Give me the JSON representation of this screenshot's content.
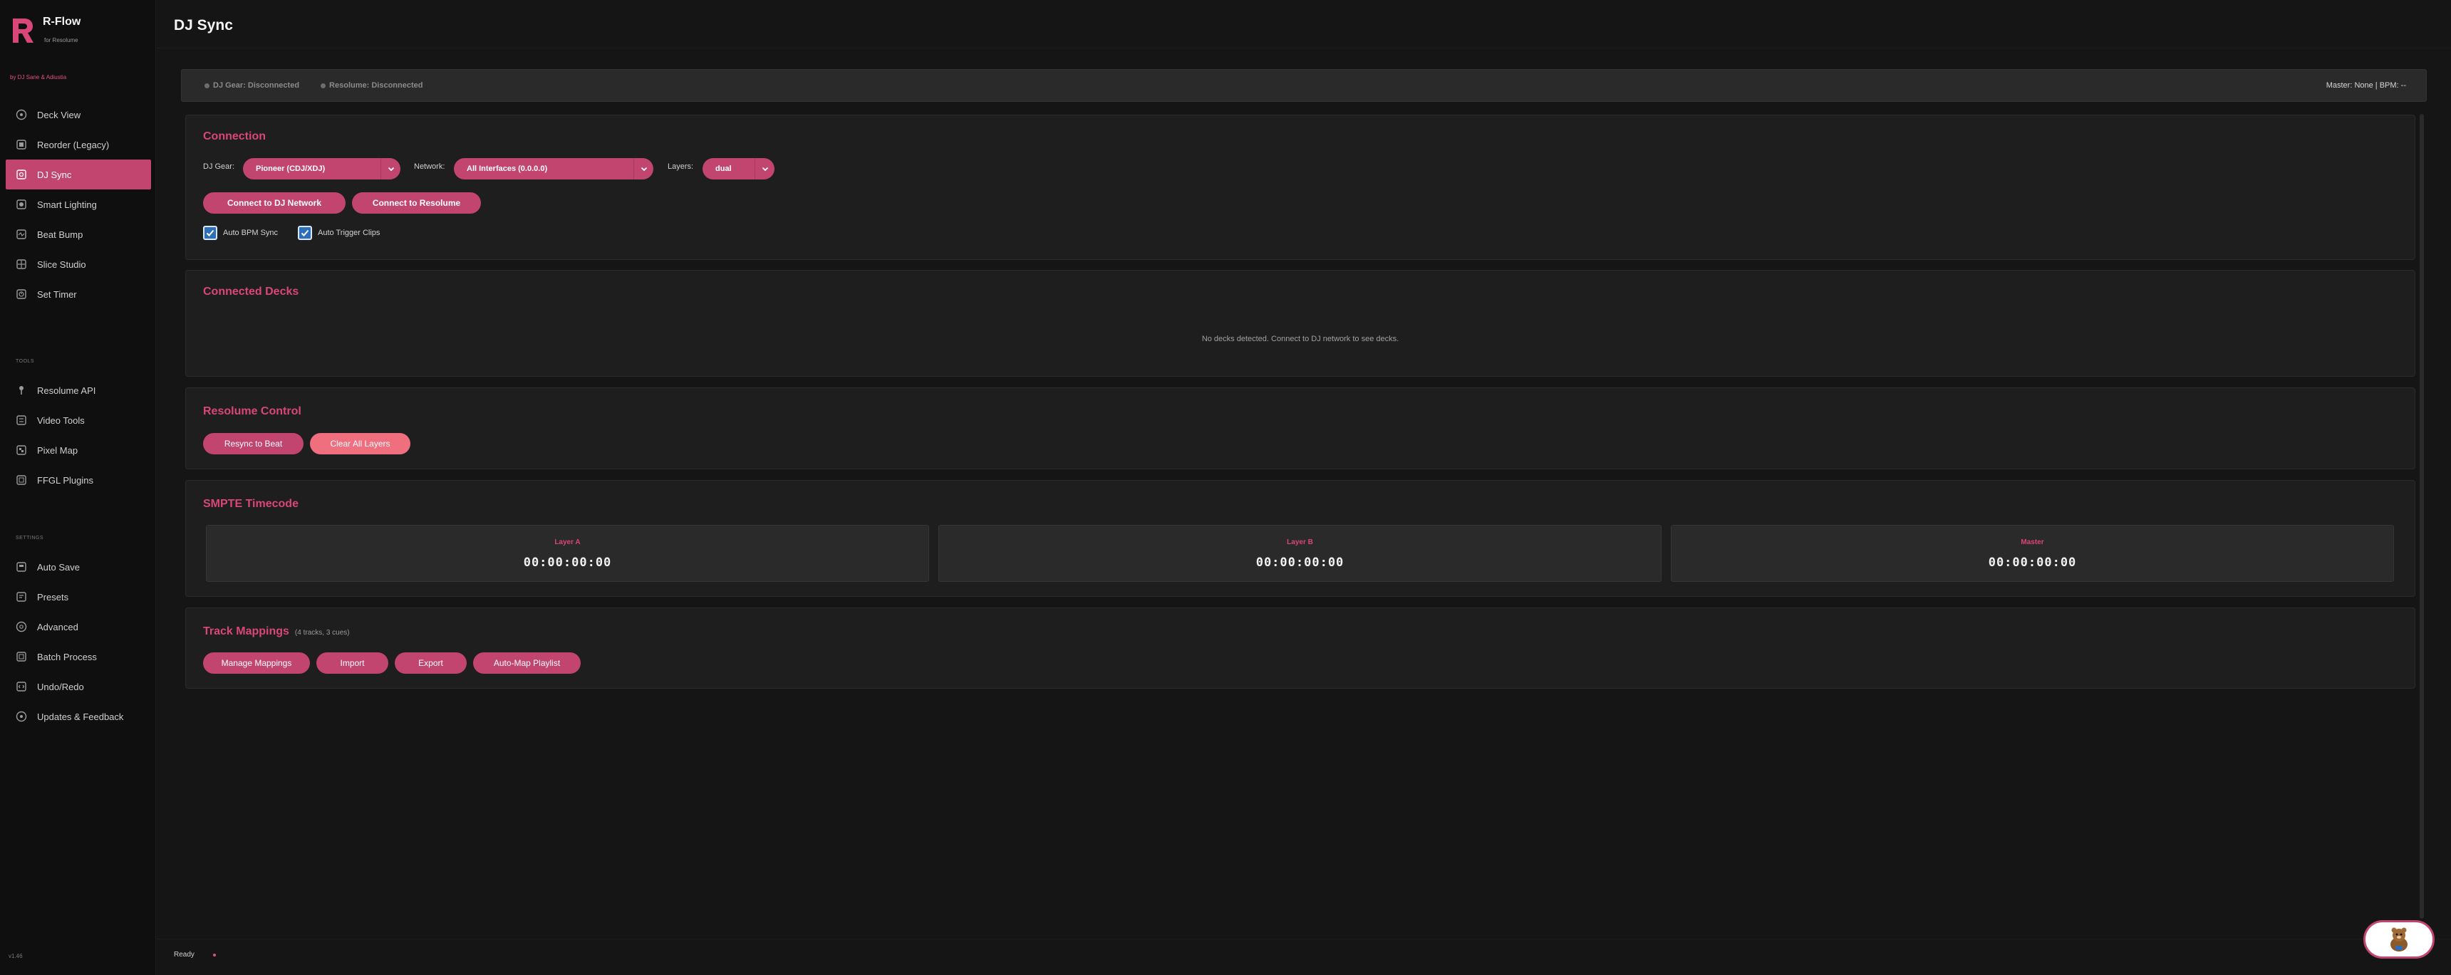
{
  "brand": {
    "title": "R-Flow",
    "subtitle": "for Resolume",
    "byline": "by DJ Sane & Adiustia"
  },
  "sidebar": {
    "main_items": [
      {
        "label": "Deck View",
        "icon": "deck-view-icon"
      },
      {
        "label": "Reorder (Legacy)",
        "icon": "reorder-icon"
      },
      {
        "label": "DJ Sync",
        "icon": "dj-sync-icon",
        "active": true
      },
      {
        "label": "Smart Lighting",
        "icon": "smart-lighting-icon"
      },
      {
        "label": "Beat Bump",
        "icon": "beat-bump-icon"
      },
      {
        "label": "Slice Studio",
        "icon": "slice-studio-icon"
      },
      {
        "label": "Set Timer",
        "icon": "set-timer-icon"
      }
    ],
    "tools_label": "TOOLS",
    "tools_items": [
      {
        "label": "Resolume API",
        "icon": "resolume-api-icon"
      },
      {
        "label": "Video Tools",
        "icon": "video-tools-icon"
      },
      {
        "label": "Pixel Map",
        "icon": "pixel-map-icon"
      },
      {
        "label": "FFGL Plugins",
        "icon": "ffgl-plugins-icon"
      }
    ],
    "settings_label": "SETTINGS",
    "settings_items": [
      {
        "label": "Auto Save",
        "icon": "auto-save-icon"
      },
      {
        "label": "Presets",
        "icon": "presets-icon"
      },
      {
        "label": "Advanced",
        "icon": "advanced-icon"
      },
      {
        "label": "Batch Process",
        "icon": "batch-process-icon"
      },
      {
        "label": "Undo/Redo",
        "icon": "undo-redo-icon"
      },
      {
        "label": "Updates & Feedback",
        "icon": "updates-feedback-icon"
      }
    ],
    "version": "v1.46"
  },
  "header": {
    "title": "DJ Sync"
  },
  "status": {
    "dj_gear": "DJ Gear: Disconnected",
    "resolume": "Resolume: Disconnected",
    "master": "Master: None | BPM: --"
  },
  "connection": {
    "title": "Connection",
    "dj_gear_label": "DJ Gear:",
    "dj_gear_value": "Pioneer (CDJ/XDJ)",
    "network_label": "Network:",
    "network_value": "All Interfaces (0.0.0.0)",
    "layers_label": "Layers:",
    "layers_value": "dual",
    "connect_dj_button": "Connect to DJ Network",
    "connect_resolume_button": "Connect to Resolume",
    "auto_bpm_label": "Auto BPM Sync",
    "auto_bpm_checked": true,
    "auto_trigger_label": "Auto Trigger Clips",
    "auto_trigger_checked": true
  },
  "decks": {
    "title": "Connected Decks",
    "empty_message": "No decks detected. Connect to DJ network to see decks."
  },
  "resolume_control": {
    "title": "Resolume Control",
    "resync_button": "Resync to Beat",
    "clear_button": "Clear All Layers"
  },
  "smpte": {
    "title": "SMPTE Timecode",
    "boxes": [
      {
        "label": "Layer A",
        "value": "00:00:00:00"
      },
      {
        "label": "Layer B",
        "value": "00:00:00:00"
      },
      {
        "label": "Master",
        "value": "00:00:00:00"
      }
    ]
  },
  "mappings": {
    "title": "Track Mappings",
    "count_note": "(4 tracks, 3 cues)",
    "manage_button": "Manage Mappings",
    "import_button": "Import",
    "export_button": "Export",
    "auto_map_button": "Auto-Map Playlist"
  },
  "footer": {
    "status": "Ready"
  },
  "colors": {
    "accent": "#c2456f",
    "accent_text": "#d9467a",
    "light_button": "#ef6f7f",
    "background": "#151515",
    "panel": "#1e1e1e"
  }
}
